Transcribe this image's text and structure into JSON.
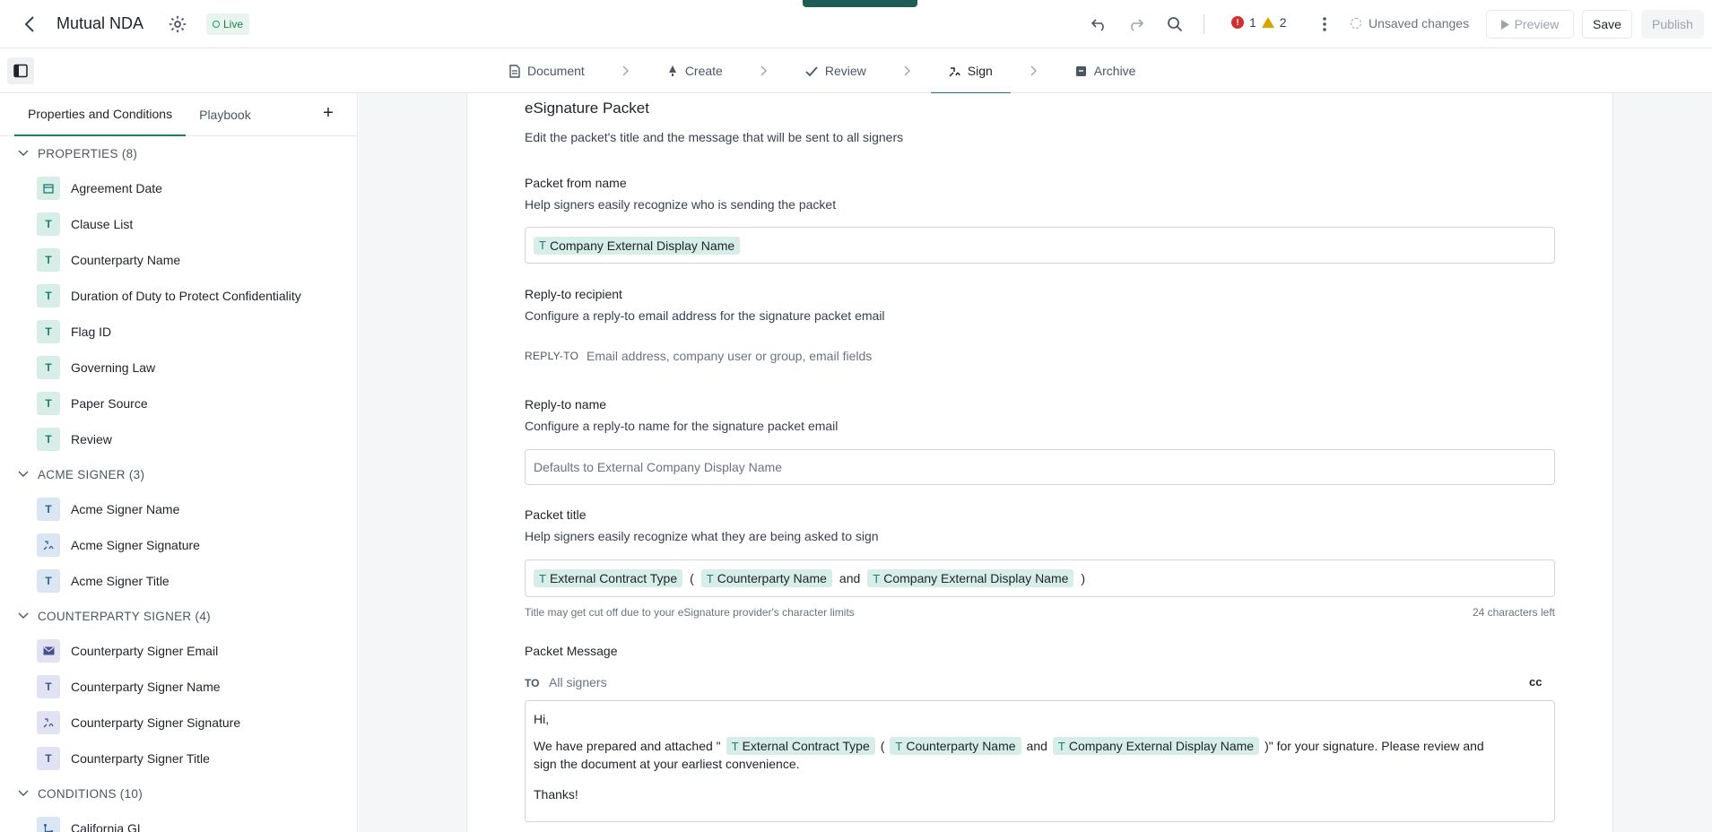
{
  "header": {
    "title": "Mutual NDA",
    "status": "Live",
    "errors": "1",
    "warnings": "2",
    "unsaved": "Unsaved changes",
    "preview_label": "Preview",
    "save_label": "Save",
    "publish_label": "Publish"
  },
  "steps": [
    {
      "label": "Document",
      "icon": "document-icon"
    },
    {
      "label": "Create",
      "icon": "rocket-icon"
    },
    {
      "label": "Review",
      "icon": "check-icon"
    },
    {
      "label": "Sign",
      "icon": "sign-icon"
    },
    {
      "label": "Archive",
      "icon": "archive-icon"
    }
  ],
  "sidebar": {
    "tabs": [
      "Properties and Conditions",
      "Playbook"
    ],
    "groups": [
      {
        "title": "PROPERTIES (8)",
        "items": [
          {
            "label": "Agreement Date",
            "icon": "calendar-icon"
          },
          {
            "label": "Clause List",
            "icon": "text-icon"
          },
          {
            "label": "Counterparty Name",
            "icon": "text-icon"
          },
          {
            "label": "Duration of Duty to Protect Confidentiality",
            "icon": "text-icon"
          },
          {
            "label": "Flag ID",
            "icon": "text-icon"
          },
          {
            "label": "Governing Law",
            "icon": "text-icon"
          },
          {
            "label": "Paper Source",
            "icon": "text-icon"
          },
          {
            "label": "Review",
            "icon": "text-icon"
          }
        ]
      },
      {
        "title": "ACME SIGNER (3)",
        "items": [
          {
            "label": "Acme Signer Name",
            "icon": "text-icon"
          },
          {
            "label": "Acme Signer Signature",
            "icon": "signature-icon"
          },
          {
            "label": "Acme Signer Title",
            "icon": "text-icon"
          }
        ]
      },
      {
        "title": "COUNTERPARTY SIGNER (4)",
        "items": [
          {
            "label": "Counterparty Signer Email",
            "icon": "mail-icon"
          },
          {
            "label": "Counterparty Signer Name",
            "icon": "text-icon"
          },
          {
            "label": "Counterparty Signer Signature",
            "icon": "signature-icon"
          },
          {
            "label": "Counterparty Signer Title",
            "icon": "text-icon"
          }
        ]
      },
      {
        "title": "CONDITIONS (10)",
        "items": [
          {
            "label": "California GL",
            "icon": "condition-icon"
          }
        ]
      }
    ]
  },
  "packet": {
    "heading": "eSignature Packet",
    "description": "Edit the packet's title and the message that will be sent to all signers",
    "from_label": "Packet from name",
    "from_help": "Help signers easily recognize who is sending the packet",
    "from_chip": "Company External Display Name",
    "reply_label": "Reply-to recipient",
    "reply_help": "Configure a reply-to email address for the signature packet email",
    "reply_prefix": "REPLY-TO",
    "reply_placeholder": "Email address, company user or group, email fields",
    "reply_name_label": "Reply-to name",
    "reply_name_help": "Configure a reply-to name for the signature packet email",
    "reply_name_placeholder": "Defaults to External Company Display Name",
    "title_label": "Packet title",
    "title_help": "Help signers easily recognize what they are being asked to sign",
    "title_chip1": "External Contract Type",
    "title_paren_open": "(",
    "title_chip2": "Counterparty Name",
    "title_and": "and",
    "title_chip3": "Company External Display Name",
    "title_paren_close": ")",
    "title_warning": "Title may get cut off due to your eSignature provider's character limits",
    "title_chars_left": "24 characters left",
    "message_label": "Packet Message",
    "to_prefix": "TO",
    "to_value": "All signers",
    "cc_label": "cc",
    "msg_greeting": "Hi,",
    "msg_pre": "We have prepared and attached \"",
    "msg_chip1": "External Contract Type",
    "msg_paren_open": "(",
    "msg_chip2": "Counterparty Name",
    "msg_and": "and",
    "msg_chip3": "Company External Display Name",
    "msg_post": ")\" for your signature. Please review and",
    "msg_line2": "sign the document at your earliest convenience.",
    "msg_thanks": "Thanks!"
  }
}
